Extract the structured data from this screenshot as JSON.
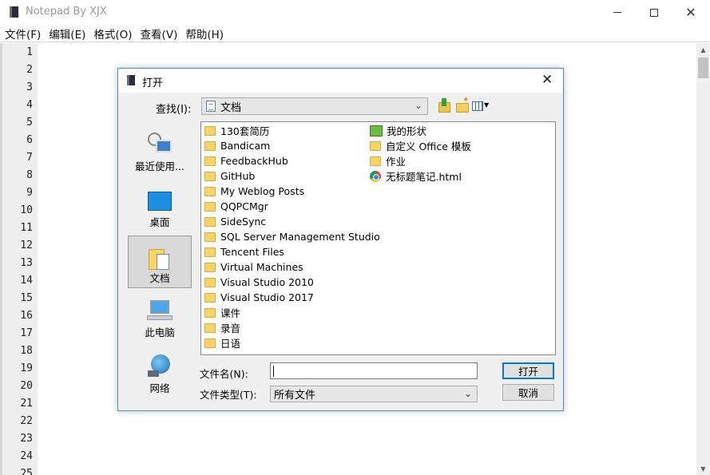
{
  "window": {
    "title": "Notepad By XJX",
    "controls": {
      "minimize": "",
      "maximize": "",
      "close": "✕"
    }
  },
  "menu": [
    "文件(F)",
    "编辑(E)",
    "格式(O)",
    "查看(V)",
    "帮助(H)"
  ],
  "editor": {
    "line_numbers": [
      "1",
      "2",
      "3",
      "4",
      "5",
      "6",
      "7",
      "8",
      "9",
      "10",
      "11",
      "12",
      "13",
      "14",
      "15",
      "16",
      "17",
      "18",
      "19",
      "20",
      "21",
      "22",
      "23",
      "24",
      "25"
    ]
  },
  "dialog": {
    "title": "打开",
    "close": "✕",
    "look_in_label": "查找(I):",
    "look_in_value": "文档",
    "places": [
      {
        "label": "最近使用...",
        "icon": "recent-places-icon"
      },
      {
        "label": "桌面",
        "icon": "desktop-icon"
      },
      {
        "label": "文档",
        "icon": "documents-icon",
        "selected": true
      },
      {
        "label": "此电脑",
        "icon": "this-pc-icon"
      },
      {
        "label": "网络",
        "icon": "network-icon"
      }
    ],
    "files_col1": [
      "130套简历",
      "Bandicam",
      "FeedbackHub",
      "GitHub",
      "My Weblog Posts",
      "QQPCMgr",
      "SideSync",
      "SQL Server Management Studio",
      "Tencent Files",
      "Virtual Machines",
      "Visual Studio 2010",
      "Visual Studio 2017",
      "课件",
      "录音",
      "日语"
    ],
    "files_col2": [
      {
        "name": "我的形状",
        "icon": "shapes-file-icon"
      },
      {
        "name": "自定义 Office 模板",
        "icon": "folder-icon"
      },
      {
        "name": "作业",
        "icon": "folder-icon"
      },
      {
        "name": "无标题笔记.html",
        "icon": "chrome-html-icon"
      }
    ],
    "filename_label": "文件名(N):",
    "filename_value": "",
    "filetype_label": "文件类型(T):",
    "filetype_value": "所有文件",
    "open_button": "打开",
    "cancel_button": "取消"
  }
}
